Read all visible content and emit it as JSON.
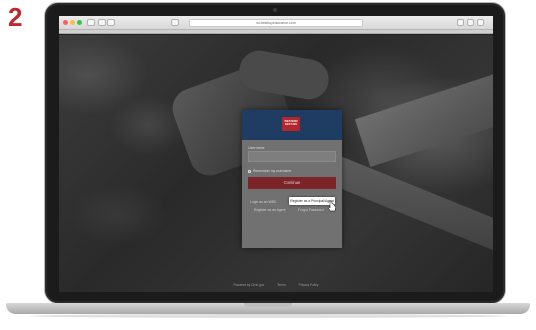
{
  "step": {
    "number": "2",
    "color": "#c0282d"
  },
  "browser": {
    "url": "wi.bestbuyinsurance.com",
    "traffic_colors": {
      "close": "#fc605c",
      "minimize": "#fdbc40",
      "maximize": "#34c84a"
    }
  },
  "login": {
    "logo_text": "WESTERN BEST INS",
    "username_label": "Username",
    "username_value": "",
    "remember_label": "Remember my username",
    "continue_label": "Continue",
    "link_wbc": "Login as an WBC",
    "link_principal": "Register as a Principal/Agent",
    "link_agent": "Register as an Agent",
    "link_forgot": "Forgot Password",
    "colors": {
      "header": "#1f3c62",
      "logo": "#b3262b",
      "button": "#7c2428"
    }
  },
  "footer": {
    "powered": "Powered by Civic.gov",
    "terms": "Terms",
    "privacy": "Privacy Policy"
  }
}
